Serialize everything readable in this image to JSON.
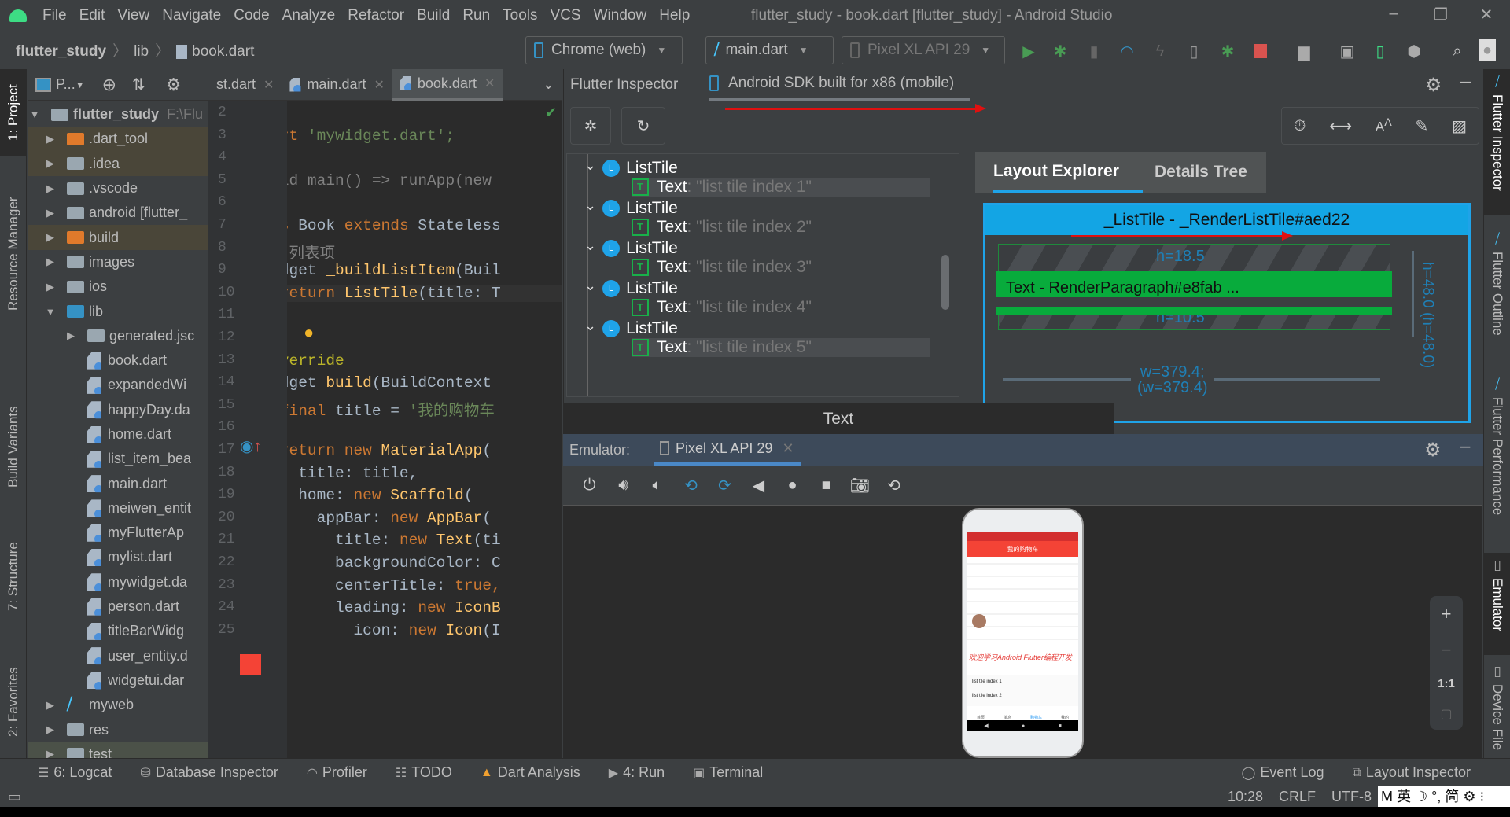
{
  "window": {
    "title": "flutter_study - book.dart [flutter_study] - Android Studio",
    "controls": [
      "minimize",
      "restore",
      "close"
    ]
  },
  "menu": [
    "File",
    "Edit",
    "View",
    "Navigate",
    "Code",
    "Analyze",
    "Refactor",
    "Build",
    "Run",
    "Tools",
    "VCS",
    "Window",
    "Help"
  ],
  "breadcrumb": [
    "flutter_study",
    "lib",
    "book.dart"
  ],
  "toolbar": {
    "device_target": "Chrome (web)",
    "run_config": "main.dart",
    "avd": "Pixel XL API 29",
    "icons": [
      "run-icon",
      "debug-icon",
      "attach-icon",
      "profile-icon",
      "apply-changes-icon",
      "apply-code-changes-icon",
      "attach-debugger-icon",
      "stop-icon",
      "project-structure-icon",
      "sdk-manager-icon",
      "avd-manager-icon",
      "sync-icon",
      "search-icon",
      "user-icon"
    ]
  },
  "left_tool_tabs": [
    "1: Project",
    "Resource Manager",
    "Build Variants",
    "7: Structure",
    "2: Favorites"
  ],
  "right_tool_tabs": [
    "Flutter Inspector",
    "Flutter Outline",
    "Flutter Performance",
    "Emulator",
    "Device File"
  ],
  "project": {
    "view_label": "P...",
    "root": {
      "name": "flutter_study",
      "path": "F:\\Flu"
    },
    "items": [
      {
        "name": ".dart_tool",
        "type": "folder-excluded",
        "expanded": false
      },
      {
        "name": ".idea",
        "type": "folder",
        "expanded": false
      },
      {
        "name": ".vscode",
        "type": "folder",
        "expanded": false
      },
      {
        "name": "android [flutter_",
        "type": "module",
        "expanded": false
      },
      {
        "name": "build",
        "type": "folder-excluded",
        "expanded": false
      },
      {
        "name": "images",
        "type": "folder",
        "expanded": false
      },
      {
        "name": "ios",
        "type": "folder",
        "expanded": false
      },
      {
        "name": "lib",
        "type": "source",
        "expanded": true
      },
      {
        "name": "generated.jsc",
        "type": "package",
        "expanded": false,
        "indent": 2
      },
      {
        "name": "book.dart",
        "type": "dart",
        "indent": 2
      },
      {
        "name": "expandedWi",
        "type": "dart",
        "indent": 2
      },
      {
        "name": "happyDay.da",
        "type": "dart",
        "indent": 2
      },
      {
        "name": "home.dart",
        "type": "dart",
        "indent": 2
      },
      {
        "name": "list_item_bea",
        "type": "dart",
        "indent": 2
      },
      {
        "name": "main.dart",
        "type": "dart",
        "indent": 2
      },
      {
        "name": "meiwen_entit",
        "type": "dart",
        "indent": 2
      },
      {
        "name": "myFlutterAp",
        "type": "dart",
        "indent": 2
      },
      {
        "name": "mylist.dart",
        "type": "dart",
        "indent": 2
      },
      {
        "name": "mywidget.da",
        "type": "dart",
        "indent": 2
      },
      {
        "name": "person.dart",
        "type": "dart",
        "indent": 2
      },
      {
        "name": "titleBarWidg",
        "type": "dart",
        "indent": 2
      },
      {
        "name": "user_entity.d",
        "type": "dart",
        "indent": 2
      },
      {
        "name": "widgetui.dar",
        "type": "dart",
        "indent": 2
      },
      {
        "name": "myweb",
        "type": "flutter-module",
        "expanded": false
      },
      {
        "name": "res",
        "type": "folder",
        "expanded": false
      },
      {
        "name": "test",
        "type": "folder",
        "expanded": false
      }
    ]
  },
  "editor": {
    "tabs": [
      {
        "label": "st.dart",
        "active": false
      },
      {
        "label": "main.dart",
        "active": false
      },
      {
        "label": "book.dart",
        "active": true
      }
    ],
    "lines": [
      {
        "n": "2",
        "code": []
      },
      {
        "n": "3",
        "code": [
          [
            "kw",
            "import "
          ],
          [
            "str",
            "'mywidget.dart';"
          ]
        ]
      },
      {
        "n": "4",
        "code": []
      },
      {
        "n": "5",
        "code": [
          [
            "cm",
            "//void main() => runApp(new_"
          ]
        ]
      },
      {
        "n": "6",
        "code": []
      },
      {
        "n": "7",
        "code": [
          [
            "kw",
            "class "
          ],
          [
            "",
            "Book "
          ],
          [
            "kw",
            "extends "
          ],
          [
            "",
            "Stateless"
          ]
        ]
      },
      {
        "n": "8",
        "code": [
          [
            "cm",
            "  // 列表项"
          ]
        ]
      },
      {
        "n": "9",
        "code": [
          [
            "",
            "  Widget "
          ],
          [
            "fn",
            "_buildListItem"
          ],
          [
            "",
            "(Buil"
          ]
        ]
      },
      {
        "n": "10",
        "code": [
          [
            "kw",
            "    return "
          ],
          [
            "fn",
            "ListTile"
          ],
          [
            "",
            "(title: T"
          ]
        ]
      },
      {
        "n": "11",
        "code": [
          [
            "",
            "  }"
          ]
        ]
      },
      {
        "n": "12",
        "code": []
      },
      {
        "n": "13",
        "code": [
          [
            "an",
            "  @"
          ],
          [
            "an",
            "override"
          ]
        ]
      },
      {
        "n": "14",
        "code": [
          [
            "",
            "  Widget "
          ],
          [
            "fn",
            "build"
          ],
          [
            "",
            "(BuildContext "
          ]
        ]
      },
      {
        "n": "15",
        "code": [
          [
            "kw",
            "    final "
          ],
          [
            "",
            "title = "
          ],
          [
            "str",
            "'我的购物车"
          ]
        ]
      },
      {
        "n": "16",
        "code": []
      },
      {
        "n": "17",
        "code": [
          [
            "kw",
            "    return new "
          ],
          [
            "fn",
            "MaterialApp"
          ],
          [
            "",
            "("
          ]
        ]
      },
      {
        "n": "18",
        "code": [
          [
            "",
            "      title: title,"
          ]
        ]
      },
      {
        "n": "19",
        "code": [
          [
            "",
            "      home: "
          ],
          [
            "kw",
            "new "
          ],
          [
            "fn",
            "Scaffold"
          ],
          [
            "",
            "("
          ]
        ]
      },
      {
        "n": "20",
        "code": [
          [
            "",
            "        appBar: "
          ],
          [
            "kw",
            "new "
          ],
          [
            "fn",
            "AppBar"
          ],
          [
            "",
            "("
          ]
        ]
      },
      {
        "n": "21",
        "code": [
          [
            "",
            "          title: "
          ],
          [
            "kw",
            "new "
          ],
          [
            "fn",
            "Text"
          ],
          [
            "",
            "(ti"
          ]
        ]
      },
      {
        "n": "22",
        "code": [
          [
            "",
            "          backgroundColor: C"
          ]
        ]
      },
      {
        "n": "23",
        "code": [
          [
            "",
            "          centerTitle: "
          ],
          [
            "kw",
            "true,"
          ]
        ]
      },
      {
        "n": "24",
        "code": [
          [
            "",
            "          leading: "
          ],
          [
            "kw",
            "new "
          ],
          [
            "fn",
            "IconB"
          ]
        ]
      },
      {
        "n": "25",
        "code": [
          [
            "",
            "            icon: "
          ],
          [
            "kw",
            "new "
          ],
          [
            "fn",
            "Icon"
          ],
          [
            "",
            "(I"
          ]
        ]
      }
    ]
  },
  "inspector": {
    "tabs": [
      {
        "label": "Flutter Inspector",
        "active": false
      },
      {
        "label": "Android SDK built for x86 (mobile)",
        "active": true
      }
    ],
    "tree": [
      {
        "kind": "ListTile",
        "badge": "L",
        "value": ""
      },
      {
        "kind": "Text",
        "badge": "T",
        "value": ": \"list tile index 1\"",
        "selected": true
      },
      {
        "kind": "ListTile",
        "badge": "L",
        "value": ""
      },
      {
        "kind": "Text",
        "badge": "T",
        "value": ": \"list tile index 2\""
      },
      {
        "kind": "ListTile",
        "badge": "L",
        "value": ""
      },
      {
        "kind": "Text",
        "badge": "T",
        "value": ": \"list tile index 3\""
      },
      {
        "kind": "ListTile",
        "badge": "L",
        "value": ""
      },
      {
        "kind": "Text",
        "badge": "T",
        "value": ": \"list tile index 4\""
      },
      {
        "kind": "ListTile",
        "badge": "L",
        "value": ""
      },
      {
        "kind": "Text",
        "badge": "T",
        "value": ": \"list tile index 5\""
      }
    ],
    "layout_tabs": [
      "Layout Explorer",
      "Details Tree"
    ],
    "layout": {
      "parent_label": "_ListTile - _RenderListTile#aed22",
      "child_label": "Text - RenderParagraph#e8fab ...",
      "top_pad": "h=18.5",
      "bottom_pad": "h=10.5",
      "height": "h=48.0",
      "height_constraint": "(h=48.0)",
      "width": "w=379.4;",
      "width_constraint": "(w=379.4)"
    },
    "properties_title": "Text"
  },
  "emulator": {
    "label": "Emulator:",
    "device_tab": "Pixel XL API 29",
    "controls": [
      "power-icon",
      "volume-up-icon",
      "volume-down-icon",
      "rotate-left-icon",
      "rotate-right-icon",
      "back-icon",
      "home-icon",
      "overview-icon",
      "screenshot-icon",
      "snapshot-icon"
    ],
    "zoom": {
      "in": "+",
      "out": "−",
      "actual": "1:1"
    },
    "phone": {
      "appbar_title": "我的购物车",
      "heading": "欢迎学习Android Flutter编程开发",
      "list_items": [
        "list tile index 1",
        "list tile index 2"
      ],
      "nav": [
        "首页",
        "消息",
        "购物车",
        "我的"
      ]
    }
  },
  "bottom_tools": [
    {
      "icon": "logcat-icon",
      "label": "6: Logcat"
    },
    {
      "icon": "database-icon",
      "label": "Database Inspector"
    },
    {
      "icon": "profiler-icon",
      "label": "Profiler"
    },
    {
      "icon": "todo-icon",
      "label": "TODO"
    },
    {
      "icon": "dart-analysis-icon",
      "label": "Dart Analysis"
    },
    {
      "icon": "run-icon",
      "label": "4: Run"
    },
    {
      "icon": "terminal-icon",
      "label": "Terminal"
    }
  ],
  "bottom_right_tools": [
    {
      "icon": "event-log-icon",
      "label": "Event Log"
    },
    {
      "icon": "layout-inspector-icon",
      "label": "Layout Inspector"
    }
  ],
  "status": {
    "position": "10:28",
    "line_sep": "CRLF",
    "encoding": "UTF-8",
    "ime": "M 英 ☽ °, 简 ⚙ ⁝"
  },
  "colors": {
    "accent_blue": "#1fa3e8",
    "layout_green": "#0aa83c",
    "annotation_red": "#e01010",
    "stop_red": "#d9534f",
    "run_green": "#499c54"
  }
}
